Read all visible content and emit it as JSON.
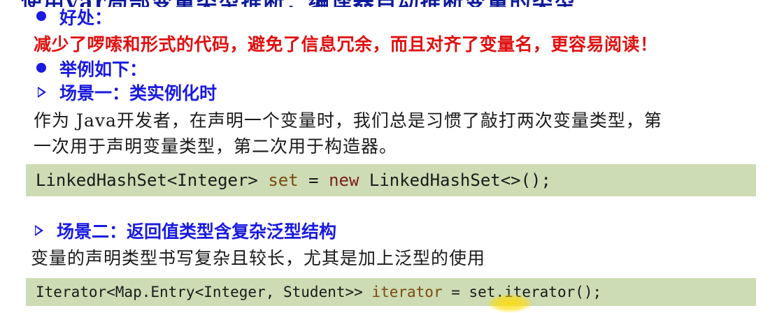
{
  "top_partial_text": "使用var局部变量类型推断：编译器自动推断变量的类型",
  "benefit_heading": "好处：",
  "benefit_text": "减少了啰嗦和形式的代码，避免了信息冗余，而且对齐了变量名，更容易阅读！",
  "examples_heading": "举例如下：",
  "scene1": {
    "title": "场景一：类实例化时",
    "para_line1": "作为 Java开发者，在声明一个变量时，我们总是习惯了敲打两次变量类型，第",
    "para_line2": "一次用于声明变量类型，第二次用于构造器。",
    "code": {
      "type_part": "LinkedHashSet<Integer> ",
      "var_name": "set",
      "eq": " = ",
      "keyword": "new",
      "rest": " LinkedHashSet<>();"
    }
  },
  "scene2": {
    "title": "场景二：返回值类型含复杂泛型结构",
    "para": "变量的声明类型书写复杂且较长，尤其是加上泛型的使用",
    "code": {
      "type_part": "Iterator<Map.Entry<Integer, Student>> ",
      "var_name": "iterator",
      "rest": " = set.iterator();"
    }
  },
  "colors": {
    "heading_blue": "#1a1ae0",
    "benefit_red": "#e01010",
    "code_bg": "#cddcb4"
  }
}
